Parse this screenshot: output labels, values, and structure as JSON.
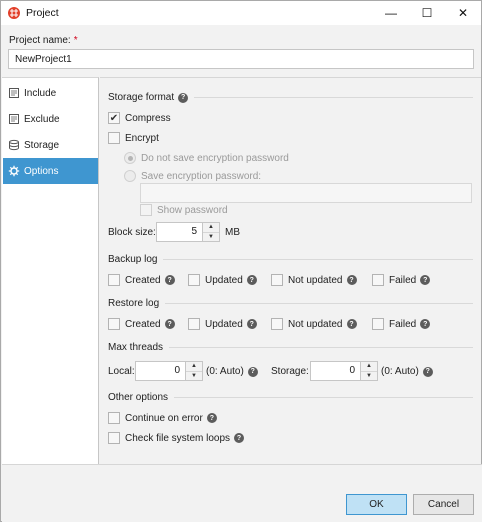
{
  "window": {
    "title": "Project",
    "minimize_glyph": "—",
    "maximize_glyph": "☐",
    "close_glyph": "✕"
  },
  "project_name": {
    "label": "Project name:",
    "required_mark": "*",
    "value": "NewProject1"
  },
  "sidebar": {
    "items": [
      {
        "label": "Include",
        "icon": "include-icon",
        "active": false
      },
      {
        "label": "Exclude",
        "icon": "exclude-icon",
        "active": false
      },
      {
        "label": "Storage",
        "icon": "storage-icon",
        "active": false
      },
      {
        "label": "Options",
        "icon": "gear-icon",
        "active": true
      }
    ]
  },
  "options": {
    "storage_format": {
      "title": "Storage format",
      "compress": {
        "label": "Compress",
        "checked": true
      },
      "encrypt": {
        "label": "Encrypt",
        "checked": false
      },
      "no_save_password": {
        "label": "Do not save encryption password",
        "selected": true
      },
      "save_password": {
        "label": "Save encryption password:",
        "selected": false
      },
      "password_value": "",
      "show_password": {
        "label": "Show password",
        "checked": false
      }
    },
    "block_size": {
      "label": "Block size:",
      "value": "5",
      "unit": "MB"
    },
    "backup_log": {
      "title": "Backup log",
      "items": [
        {
          "label": "Created",
          "checked": false
        },
        {
          "label": "Updated",
          "checked": false
        },
        {
          "label": "Not updated",
          "checked": false
        },
        {
          "label": "Failed",
          "checked": false
        }
      ]
    },
    "restore_log": {
      "title": "Restore log",
      "items": [
        {
          "label": "Created",
          "checked": false
        },
        {
          "label": "Updated",
          "checked": false
        },
        {
          "label": "Not updated",
          "checked": false
        },
        {
          "label": "Failed",
          "checked": false
        }
      ]
    },
    "max_threads": {
      "title": "Max threads",
      "local": {
        "label": "Local:",
        "value": "0",
        "hint": "(0: Auto)"
      },
      "storage": {
        "label": "Storage:",
        "value": "0",
        "hint": "(0: Auto)"
      }
    },
    "other_options": {
      "title": "Other options",
      "continue_on_error": {
        "label": "Continue on error",
        "checked": false
      },
      "check_file_system_loops": {
        "label": "Check file system loops",
        "checked": false
      }
    }
  },
  "footer": {
    "ok_label": "OK",
    "cancel_label": "Cancel"
  },
  "help_glyph": "?",
  "check_glyph": "✔",
  "spin_up_glyph": "▲",
  "spin_down_glyph": "▼",
  "colors": {
    "accent": "#3f96d0",
    "required": "#d0021b"
  }
}
